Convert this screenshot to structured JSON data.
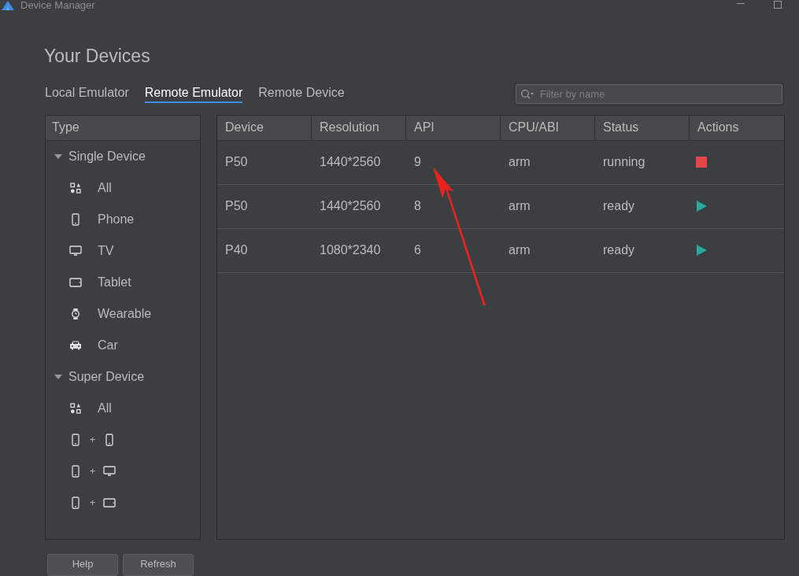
{
  "window": {
    "title": "Device Manager"
  },
  "heading": "Your Devices",
  "tabs": [
    {
      "label": "Local Emulator",
      "selected": false
    },
    {
      "label": "Remote Emulator",
      "selected": true
    },
    {
      "label": "Remote Device",
      "selected": false
    }
  ],
  "search": {
    "placeholder": "Filter by name"
  },
  "sidebar": {
    "header": "Type",
    "groups": [
      {
        "label": "Single Device",
        "expanded": true,
        "children": [
          {
            "kind": "all",
            "label": "All"
          },
          {
            "kind": "phone",
            "label": "Phone"
          },
          {
            "kind": "tv",
            "label": "TV"
          },
          {
            "kind": "tablet",
            "label": "Tablet"
          },
          {
            "kind": "wearable",
            "label": "Wearable"
          },
          {
            "kind": "car",
            "label": "Car"
          }
        ]
      },
      {
        "label": "Super Device",
        "expanded": true,
        "children": [
          {
            "kind": "all",
            "label": "All"
          },
          {
            "kind": "phone-phone",
            "label": "+"
          },
          {
            "kind": "phone-tv",
            "label": "+"
          },
          {
            "kind": "phone-tablet",
            "label": "+"
          }
        ]
      }
    ]
  },
  "table": {
    "columns": [
      "Device",
      "Resolution",
      "API",
      "CPU/ABI",
      "Status",
      "Actions"
    ],
    "rows": [
      {
        "cells": [
          "P50",
          "1440*2560",
          "9",
          "arm",
          "running"
        ],
        "kind": "stop"
      },
      {
        "cells": [
          "P50",
          "1440*2560",
          "8",
          "arm",
          "ready"
        ],
        "kind": "start"
      },
      {
        "cells": [
          "P40",
          "1080*2340",
          "6",
          "arm",
          "ready"
        ],
        "kind": "start"
      }
    ]
  },
  "buttons": [
    "Help",
    "Refresh"
  ]
}
